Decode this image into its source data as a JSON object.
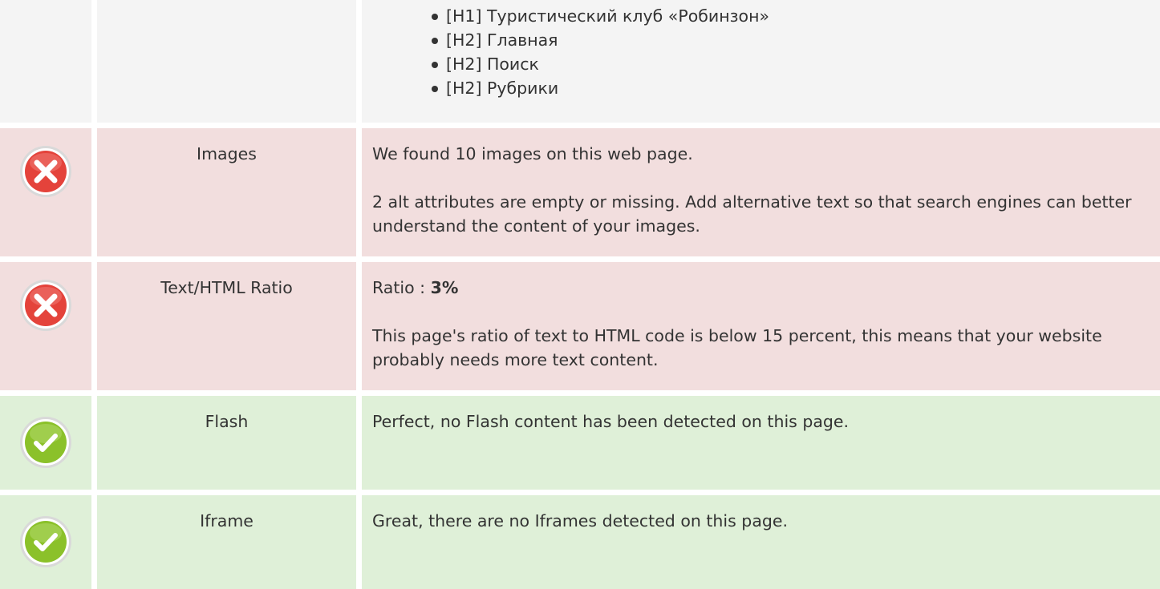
{
  "headings": {
    "items": [
      "[H1] Туристический клуб «Робинзон»",
      "[H2] Главная",
      "[H2] Поиск",
      "[H2] Рубрики"
    ]
  },
  "images": {
    "status": "fail",
    "label": "Images",
    "line1": "We found 10 images on this web page.",
    "line2": "2 alt attributes are empty or missing. Add alternative text so that search engines can better understand the content of your images."
  },
  "ratio": {
    "status": "fail",
    "label": "Text/HTML Ratio",
    "prefix": "Ratio : ",
    "value": "3%",
    "line2": "This page's ratio of text to HTML code is below 15 percent, this means that your website probably needs more text content."
  },
  "flash": {
    "status": "pass",
    "label": "Flash",
    "line1": "Perfect, no Flash content has been detected on this page."
  },
  "iframe": {
    "status": "pass",
    "label": "Iframe",
    "line1": "Great, there are no Iframes detected on this page."
  },
  "colors": {
    "fail_bg": "#f2dede",
    "pass_bg": "#dff0d8",
    "neutral_bg": "#f4f4f4",
    "fail_icon": "#e4433b",
    "pass_icon": "#8bc12a"
  },
  "icons": {
    "fail": "error-x-icon",
    "pass": "check-icon"
  }
}
